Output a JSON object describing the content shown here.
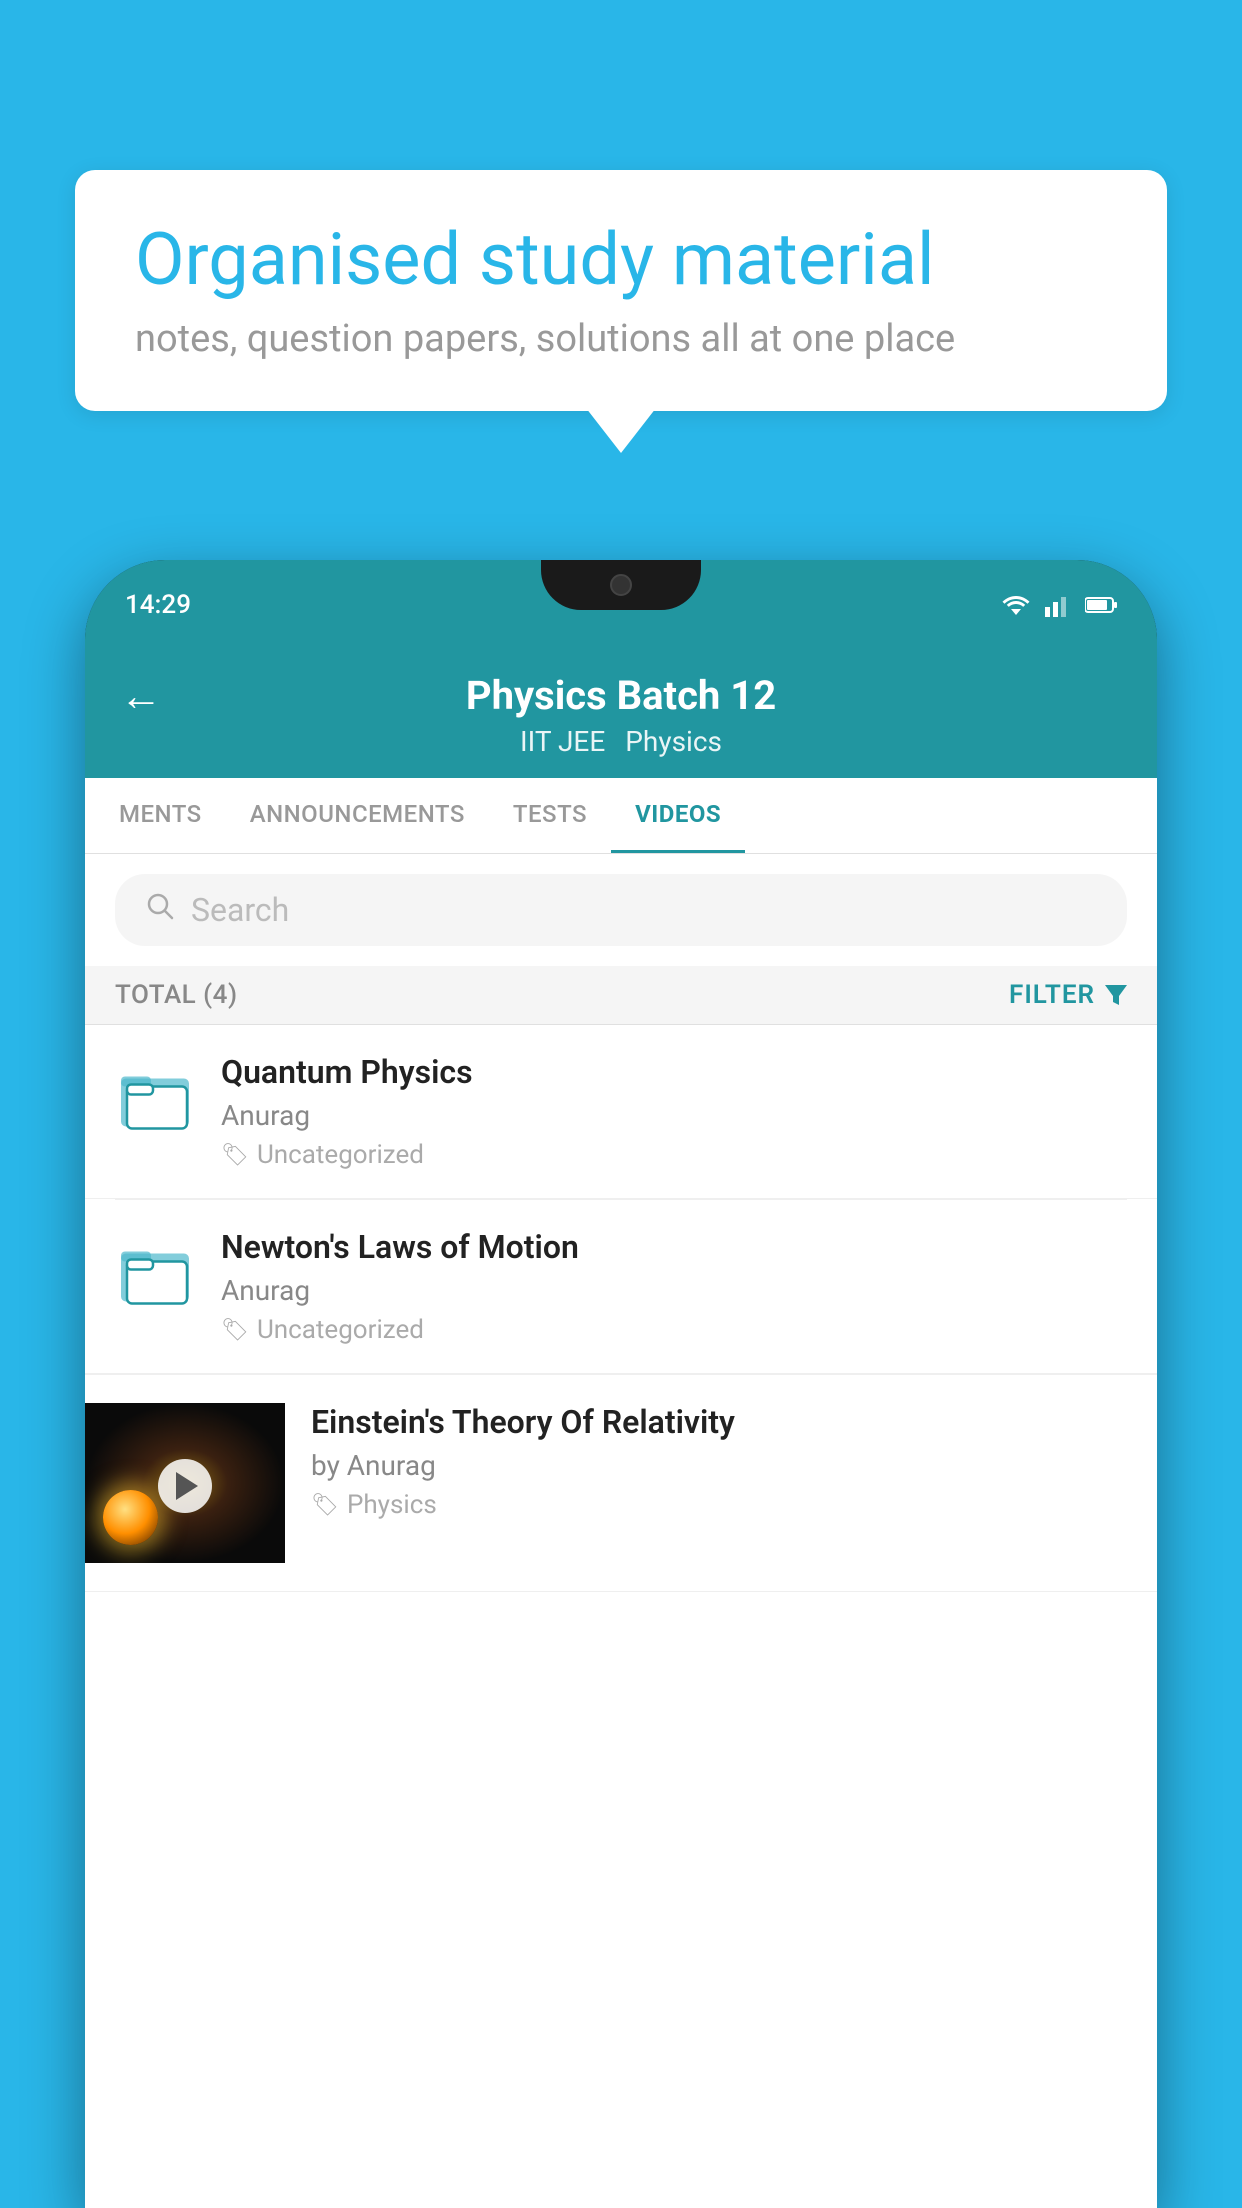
{
  "background_color": "#29b6e8",
  "bubble": {
    "title": "Organised study material",
    "subtitle": "notes, question papers, solutions all at one place"
  },
  "phone": {
    "status_time": "14:29"
  },
  "header": {
    "back_label": "←",
    "title": "Physics Batch 12",
    "tag1": "IIT JEE",
    "tag2": "Physics"
  },
  "tabs": [
    {
      "label": "MENTS",
      "active": false
    },
    {
      "label": "ANNOUNCEMENTS",
      "active": false
    },
    {
      "label": "TESTS",
      "active": false
    },
    {
      "label": "VIDEOS",
      "active": true
    }
  ],
  "search": {
    "placeholder": "Search"
  },
  "filter_bar": {
    "total_label": "TOTAL (4)",
    "filter_label": "FILTER"
  },
  "videos": [
    {
      "id": 1,
      "title": "Quantum Physics",
      "author": "Anurag",
      "tag": "Uncategorized",
      "type": "folder"
    },
    {
      "id": 2,
      "title": "Newton's Laws of Motion",
      "author": "Anurag",
      "tag": "Uncategorized",
      "type": "folder"
    },
    {
      "id": 3,
      "title": "Einstein's Theory Of Relativity",
      "author": "by Anurag",
      "tag": "Physics",
      "type": "video"
    }
  ]
}
